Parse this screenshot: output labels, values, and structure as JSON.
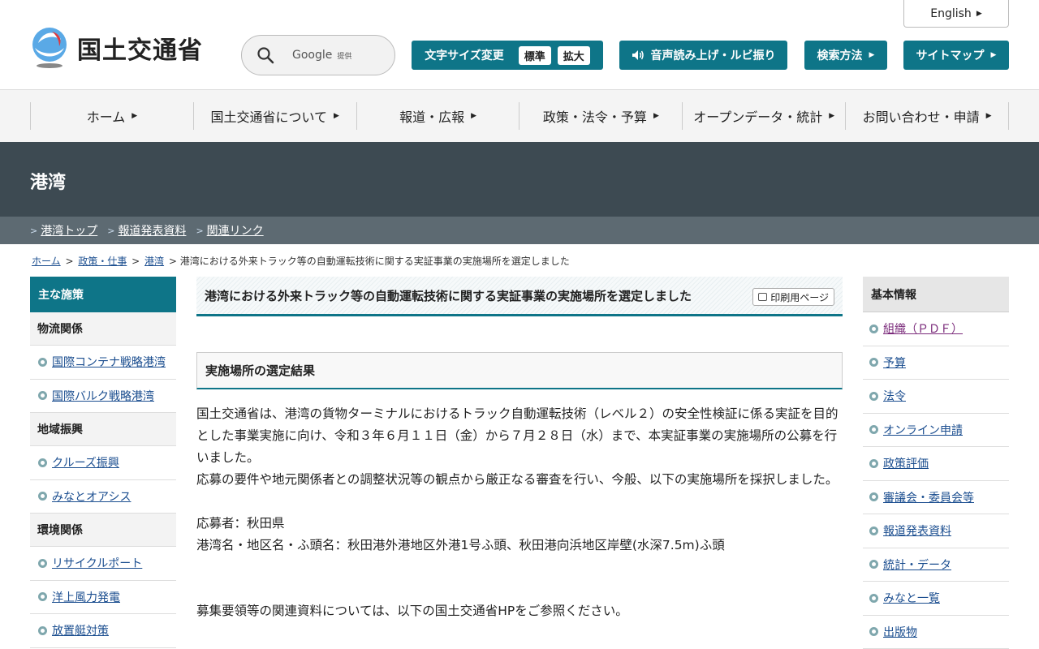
{
  "header": {
    "logo_text": "国土交通省",
    "search": {
      "provider": "Google",
      "provider_note": "提供"
    },
    "english_link": "English",
    "font_size": {
      "label": "文字サイズ変更",
      "standard": "標準",
      "large": "拡大"
    },
    "speech_label": "音声読み上げ・ルビ振り",
    "search_method_label": "検索方法",
    "sitemap_label": "サイトマップ"
  },
  "nav": {
    "items": [
      "ホーム",
      "国土交通省について",
      "報道・広報",
      "政策・法令・予算",
      "オープンデータ・統計",
      "お問い合わせ・申請"
    ]
  },
  "banner": {
    "title": "港湾",
    "subnav": [
      "港湾トップ",
      "報道発表資料",
      "関連リンク"
    ]
  },
  "breadcrumb": {
    "links": [
      "ホーム",
      "政策・仕事",
      "港湾"
    ],
    "current": "港湾における外来トラック等の自動運転技術に関する実証事業の実施場所を選定しました"
  },
  "left_sidebar": {
    "heading": "主な施策",
    "groups": [
      {
        "category": "物流関係",
        "links": [
          "国際コンテナ戦略港湾",
          "国際バルク戦略港湾"
        ]
      },
      {
        "category": "地域振興",
        "links": [
          "クルーズ振興",
          "みなとオアシス"
        ]
      },
      {
        "category": "環境関係",
        "links": [
          "リサイクルポート",
          "洋上風力発電",
          "放置艇対策"
        ]
      }
    ]
  },
  "main": {
    "title": "港湾における外来トラック等の自動運転技術に関する実証事業の実施場所を選定しました",
    "print_label": "印刷用ページ",
    "section_title": "実施場所の選定結果",
    "paragraph1": "国土交通省は、港湾の貨物ターミナルにおけるトラック自動運転技術（レベル２）の安全性検証に係る実証を目的とした事業実施に向け、令和３年６月１１日（金）から７月２８日（水）まで、本実証事業の実施場所の公募を行いました。",
    "paragraph2": "応募の要件や地元関係者との調整状況等の観点から厳正なる審査を行い、今般、以下の実施場所を採択しました。",
    "applicant": "応募者：秋田県",
    "location": "港湾名・地区名・ふ頭名：秋田港外港地区外港1号ふ頭、秋田港向浜地区岸壁(水深7.5m)ふ頭",
    "reference": "募集要領等の関連資料については、以下の国土交通省HPをご参照ください。"
  },
  "right_sidebar": {
    "heading": "基本情報",
    "links": [
      "組織（ＰＤＦ）",
      "予算",
      "法令",
      "オンライン申請",
      "政策評価",
      "審議会・委員会等",
      "報道発表資料",
      "統計・データ",
      "みなと一覧",
      "出版物"
    ]
  }
}
